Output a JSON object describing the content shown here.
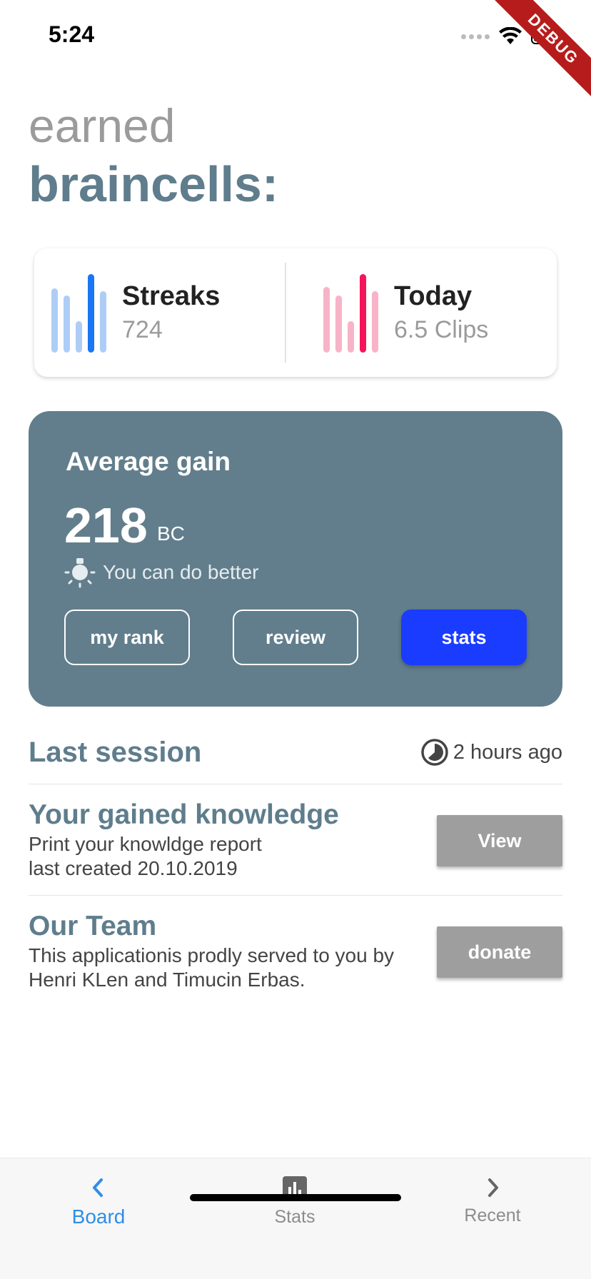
{
  "status_bar": {
    "time": "5:24",
    "debug_label": "DEBUG"
  },
  "heading": {
    "line1": "earned",
    "line2": "braincells:"
  },
  "summary": {
    "streaks": {
      "title": "Streaks",
      "value": "724",
      "bar_color": "#1976f5",
      "bar_light": "#aecdf6"
    },
    "today": {
      "title": "Today",
      "value": "6.5 Clips",
      "bar_color": "#f5135a",
      "bar_light": "#f7b3c8"
    }
  },
  "gain_card": {
    "label": "Average gain",
    "value": "218",
    "unit": "BC",
    "hint": "You can do better",
    "hint_icon": "lightbulb-icon",
    "buttons": {
      "rank": "my rank",
      "review": "review",
      "stats": "stats"
    },
    "background": "#627e8c",
    "accent": "#1a3cff"
  },
  "last_session": {
    "title": "Last session",
    "time": "2 hours ago",
    "time_icon": "clock-icon"
  },
  "knowledge": {
    "title": "Your gained knowledge",
    "line1": "Print your knowldge report",
    "line2": "last created 20.10.2019",
    "button": "View"
  },
  "team": {
    "title": "Our Team",
    "line1": "This applicationis prodly served to you by",
    "line2": "Henri KLen and Timucin Erbas.",
    "button": "donate"
  },
  "tabbar": {
    "board": {
      "label": "Board",
      "icon": "chevron-left-icon"
    },
    "stats": {
      "label": "Stats",
      "icon": "bar-chart-icon"
    },
    "recent": {
      "label": "Recent",
      "icon": "chevron-right-icon"
    }
  }
}
